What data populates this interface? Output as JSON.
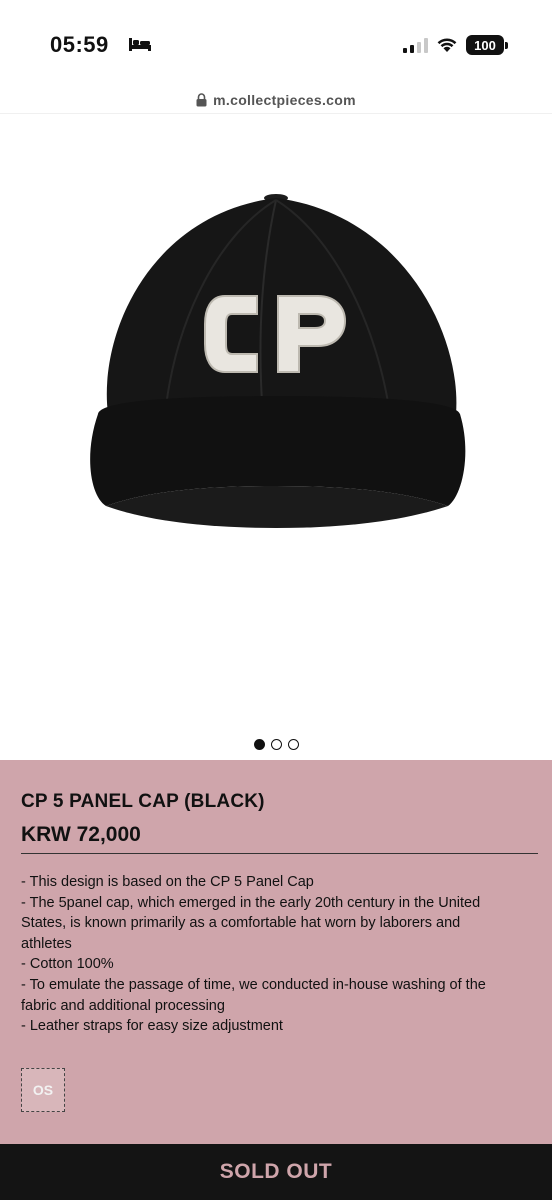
{
  "status_bar": {
    "time": "05:59",
    "battery": "100",
    "sleep_icon": "bed-icon",
    "wifi_icon": "wifi-icon"
  },
  "browser": {
    "url": "m.collectpieces.com",
    "lock_icon": "lock-icon"
  },
  "product": {
    "image_logo_text": "CP",
    "carousel": {
      "count": 3,
      "active_index": 0
    },
    "title": "CP 5 PANEL CAP (BLACK)",
    "price": "KRW 72,000",
    "description": [
      "- This design is based on the CP 5 Panel Cap",
      "- The 5panel cap, which emerged in the early 20th century in the United",
      "States, is known primarily as a comfortable hat worn by laborers and",
      "athletes",
      "- Cotton 100%",
      "- To emulate the passage of time, we conducted in-house washing of the",
      "fabric and additional processing",
      "- Leather straps for easy size adjustment"
    ],
    "size_option": "OS",
    "sold_out_label": "SOLD OUT"
  },
  "colors": {
    "panel_bg": "#cfa5ab",
    "bottom_bar": "#141414",
    "cap": "#141414",
    "patch": "#e9e6e0"
  }
}
